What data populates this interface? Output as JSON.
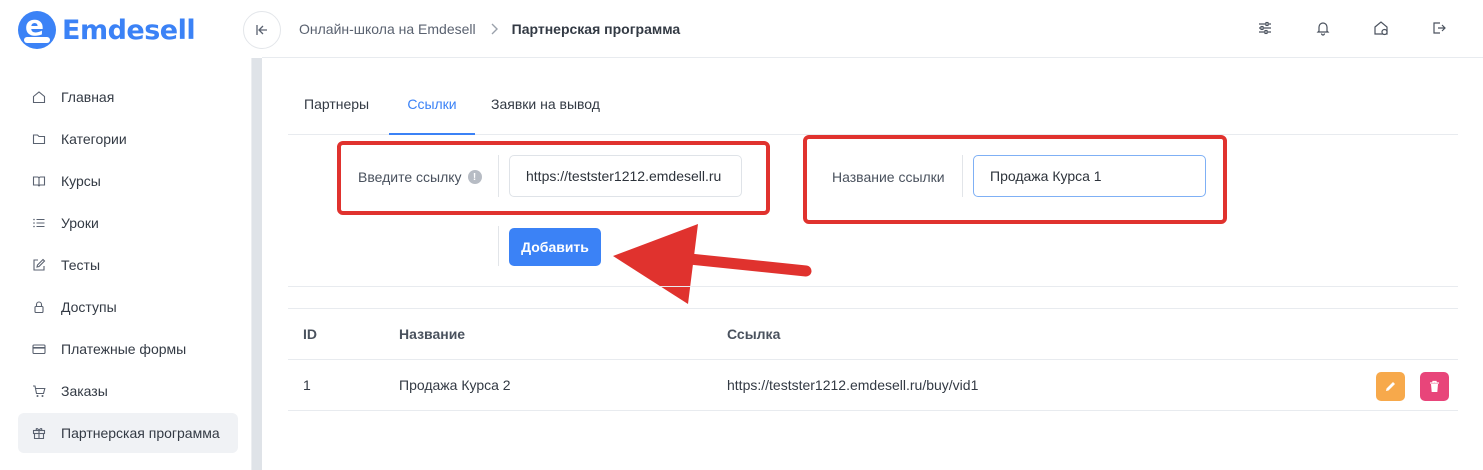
{
  "brand": {
    "name": "Emdesell",
    "logo_letter": "e",
    "color": "#3b82f6"
  },
  "header": {
    "breadcrumb": [
      "Онлайн-школа на Emdesell",
      "Партнерская программа"
    ],
    "icons": [
      "sliders-icon",
      "bell-icon",
      "home-settings-icon",
      "logout-icon"
    ]
  },
  "sidebar": {
    "items": [
      {
        "label": "Главная",
        "icon": "home-icon"
      },
      {
        "label": "Категории",
        "icon": "folder-icon"
      },
      {
        "label": "Курсы",
        "icon": "book-icon"
      },
      {
        "label": "Уроки",
        "icon": "list-icon"
      },
      {
        "label": "Тесты",
        "icon": "edit-icon"
      },
      {
        "label": "Доступы",
        "icon": "lock-icon"
      },
      {
        "label": "Платежные формы",
        "icon": "card-icon"
      },
      {
        "label": "Заказы",
        "icon": "cart-icon"
      },
      {
        "label": "Партнерская программа",
        "icon": "gift-icon",
        "active": true
      }
    ]
  },
  "tabs": [
    {
      "label": "Партнеры"
    },
    {
      "label": "Ссылки",
      "active": true
    },
    {
      "label": "Заявки на вывод"
    }
  ],
  "form": {
    "link_label": "Введите ссылку",
    "link_info": "!",
    "link_value": "https://testster1212.emdesell.ru",
    "name_label": "Название ссылки",
    "name_value": "Продажа Курса 1",
    "add_button": "Добавить"
  },
  "table": {
    "headers": [
      "ID",
      "Название",
      "Ссылка"
    ],
    "rows": [
      {
        "id": "1",
        "name": "Продажа Курса 2",
        "link": "https://testster1212.emdesell.ru/buy/vid1"
      }
    ]
  },
  "colors": {
    "annotation": "#e0322e",
    "primary": "#3b82f6",
    "edit": "#f7a94b",
    "delete": "#e8457a"
  }
}
